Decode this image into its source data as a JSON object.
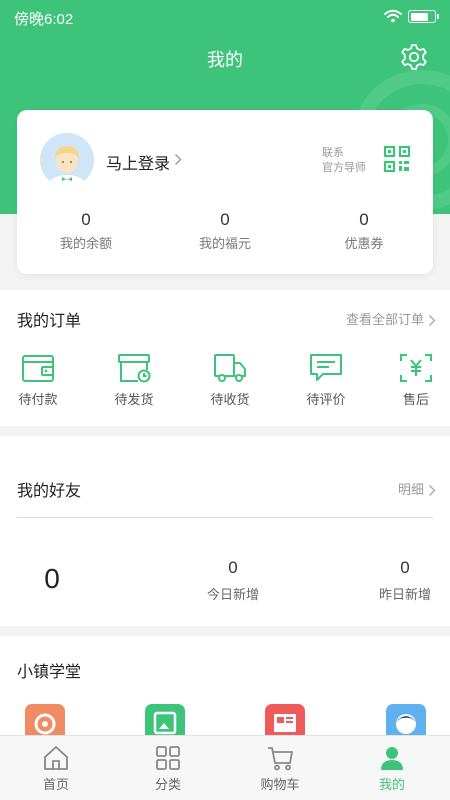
{
  "status_bar": {
    "time": "傍晚6:02",
    "battery_level": 0.8
  },
  "header": {
    "title": "我的"
  },
  "profile": {
    "login_text": "马上登录",
    "mentor_line1": "联系",
    "mentor_line2": "官方导师",
    "stats": [
      {
        "value": "0",
        "label": "我的余额"
      },
      {
        "value": "0",
        "label": "我的福元"
      },
      {
        "value": "0",
        "label": "优惠券"
      }
    ]
  },
  "orders": {
    "title": "我的订单",
    "view_all": "查看全部订单",
    "items": [
      {
        "label": "待付款",
        "icon": "wallet-icon"
      },
      {
        "label": "待发货",
        "icon": "box-clock-icon"
      },
      {
        "label": "待收货",
        "icon": "truck-icon"
      },
      {
        "label": "待评价",
        "icon": "comment-icon"
      },
      {
        "label": "售后",
        "icon": "yen-refund-icon"
      }
    ]
  },
  "friends": {
    "title": "我的好友",
    "detail_link": "明细",
    "total": "0",
    "today_value": "0",
    "today_label": "今日新增",
    "yesterday_value": "0",
    "yesterday_label": "昨日新增"
  },
  "academy": {
    "title": "小镇学堂"
  },
  "tabbar": {
    "items": [
      {
        "label": "首页",
        "icon": "home-icon"
      },
      {
        "label": "分类",
        "icon": "grid-icon"
      },
      {
        "label": "购物车",
        "icon": "cart-icon"
      },
      {
        "label": "我的",
        "icon": "user-icon"
      }
    ],
    "active_index": 3
  },
  "colors": {
    "brand": "#3dc47a",
    "background": "#f3f3f3",
    "card": "#ffffff"
  }
}
